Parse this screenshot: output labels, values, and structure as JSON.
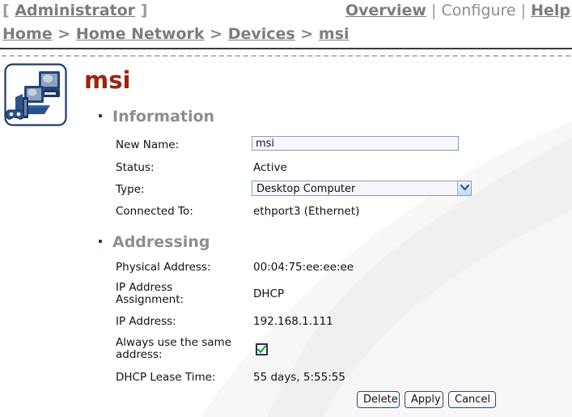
{
  "topbar": {
    "bracket_open": "[",
    "bracket_close": "]",
    "user_label": "Administrator",
    "nav": {
      "overview": "Overview",
      "separator": "|",
      "configure": "Configure",
      "help": "Help"
    }
  },
  "breadcrumb": {
    "items": [
      "Home",
      "Home Network",
      "Devices",
      "msi"
    ],
    "separator": ">"
  },
  "device": {
    "icon": "computer-device-icon",
    "title": "msi"
  },
  "sections": {
    "information": {
      "heading": "Information",
      "fields": [
        {
          "label": "New Name:",
          "value": "msi",
          "control": "text-input"
        },
        {
          "label": "Status:",
          "value": "Active",
          "control": "static"
        },
        {
          "label": "Type:",
          "value": "Desktop Computer",
          "control": "select"
        },
        {
          "label": "Connected To:",
          "value": "ethport3 (Ethernet)",
          "control": "static"
        }
      ]
    },
    "addressing": {
      "heading": "Addressing",
      "fields": [
        {
          "label": "Physical Address:",
          "value": "00:04:75:ee:ee:ee",
          "control": "static"
        },
        {
          "label_line1": "IP Address",
          "label_line2": "Assignment:",
          "value": "DHCP",
          "control": "static"
        },
        {
          "label": "IP Address:",
          "value": "192.168.1.111",
          "control": "static"
        },
        {
          "label_line1": "Always use the same",
          "label_line2": "address:",
          "value": "checked",
          "control": "checkbox"
        },
        {
          "label": "DHCP Lease Time:",
          "value": "55 days, 5:55:55",
          "control": "static"
        }
      ]
    }
  },
  "buttons": {
    "delete": "Delete",
    "apply": "Apply",
    "cancel": "Cancel"
  },
  "colors": {
    "title": "#9d2310",
    "section_heading": "#8e8e8e",
    "nav_link": "#7d7d7d",
    "bullet": "#1c3557",
    "button_border": "#2c4d79",
    "input_bg": "#f7f8ff",
    "input_border": "#8a9cb8",
    "checkmark": "#0b9b2c"
  }
}
